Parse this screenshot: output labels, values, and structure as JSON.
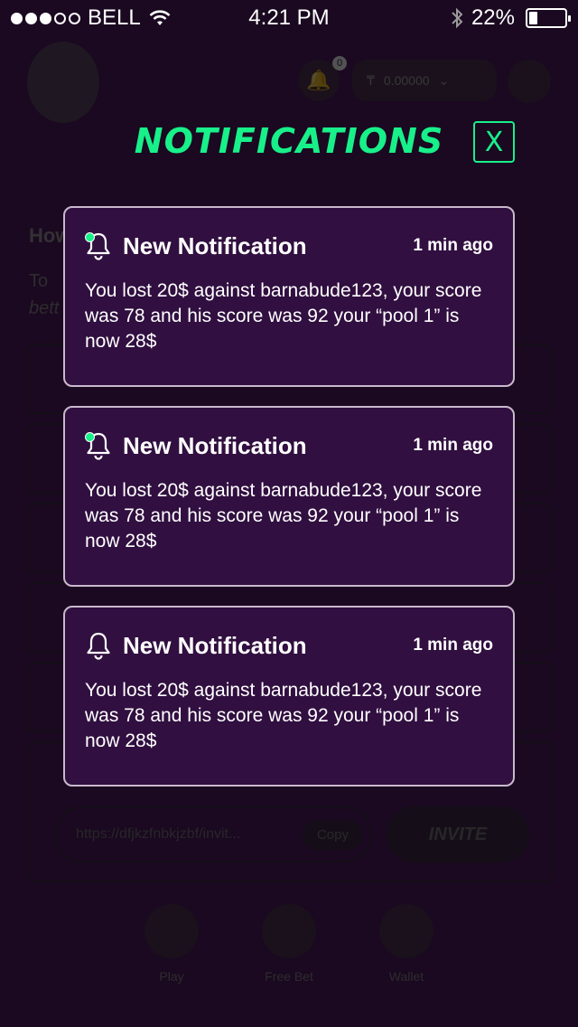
{
  "status_bar": {
    "carrier": "BELL",
    "time": "4:21 PM",
    "battery": "22%",
    "battery_level": 0.22
  },
  "background": {
    "notification_badge": "0",
    "wallet_balance": "0.00000",
    "heading": "How",
    "subtext_line1": "To",
    "subtext_line2": "bett",
    "invite_link": "https://dfjkzfnbkjzbf/invit...",
    "copy_label": "Copy",
    "invite_label": "INVITE",
    "nav": [
      "Play",
      "Free Bet",
      "Wallet"
    ]
  },
  "modal": {
    "title": "NOTIFICATIONS",
    "close_label": "X",
    "notifications": [
      {
        "title": "New Notification",
        "time": "1 min ago",
        "body": "You lost 20$ against barnabude123, your score was 78 and his score was 92 your “pool 1” is now 28$",
        "unread": true
      },
      {
        "title": "New Notification",
        "time": "1 min ago",
        "body": "You lost 20$ against barnabude123, your score was 78 and his score was 92 your “pool 1” is now 28$",
        "unread": true
      },
      {
        "title": "New Notification",
        "time": "1 min ago",
        "body": "You lost 20$ against barnabude123, your score was 78 and his score was 92 your “pool 1” is now 28$",
        "unread": false
      }
    ]
  },
  "colors": {
    "accent": "#18f08a",
    "card_bg": "#310f40",
    "page_bg": "#1a0920"
  }
}
